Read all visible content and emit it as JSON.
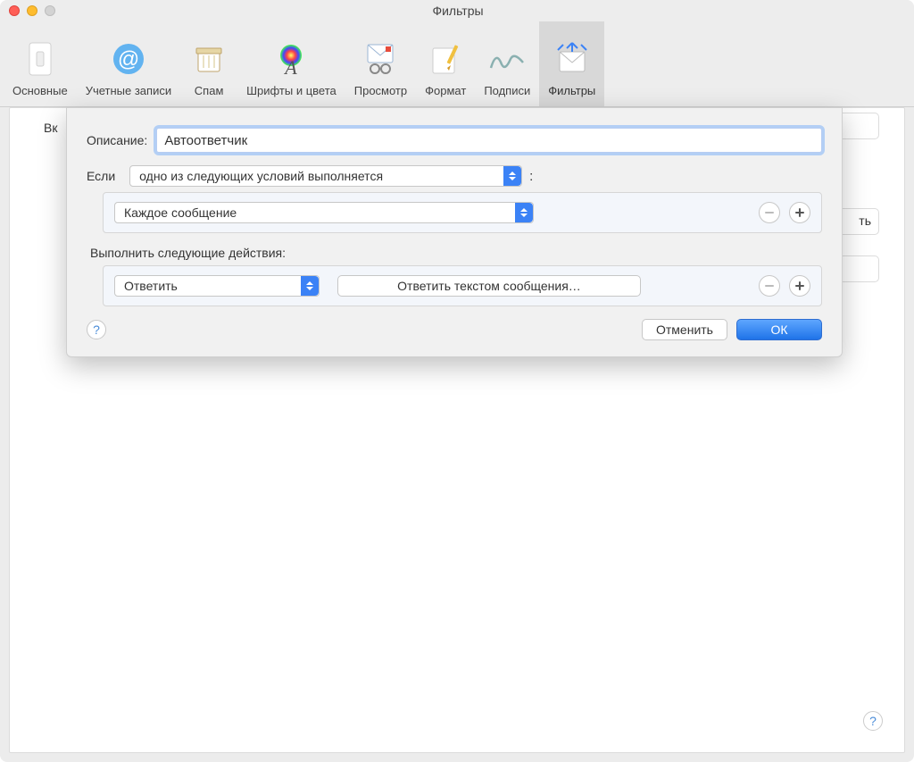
{
  "window": {
    "title": "Фильтры"
  },
  "toolbar": {
    "items": [
      {
        "label": "Основные"
      },
      {
        "label": "Учетные записи"
      },
      {
        "label": "Спам"
      },
      {
        "label": "Шрифты и цвета"
      },
      {
        "label": "Просмотр"
      },
      {
        "label": "Формат"
      },
      {
        "label": "Подписи"
      },
      {
        "label": "Фильтры"
      }
    ],
    "active_index": 7
  },
  "background": {
    "col_toggle": "Вк",
    "partial_button": "ть"
  },
  "sheet": {
    "description_label": "Описание:",
    "description_value": "Автоответчик",
    "if_label": "Если",
    "if_condition": "одно из следующих условий выполняется",
    "colon": ":",
    "condition_rule": "Каждое сообщение",
    "actions_label": "Выполнить следующие действия:",
    "action_type": "Ответить",
    "action_detail": "Ответить текстом сообщения…",
    "cancel": "Отменить",
    "ok": "ОК",
    "help_char": "?"
  }
}
